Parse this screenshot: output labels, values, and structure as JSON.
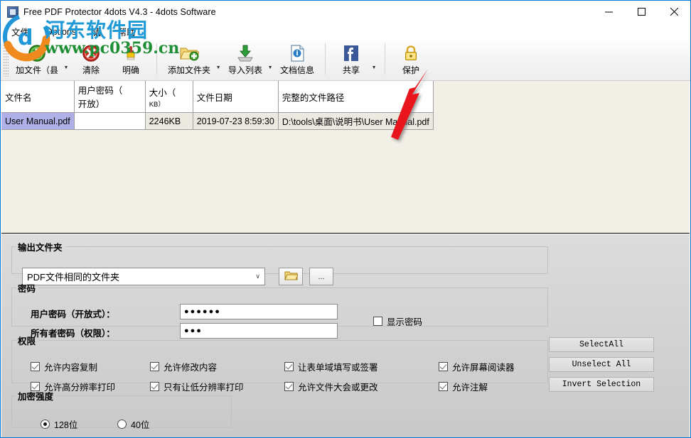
{
  "window": {
    "title": "Free PDF Protector 4dots V4.3 - 4dots Software",
    "icon": "app-icon",
    "minimize": "—",
    "maximize": "□",
    "close": "✕"
  },
  "menu": {
    "items": [
      {
        "label": "文件",
        "name": "menu-file"
      },
      {
        "label": "Options",
        "name": "menu-options"
      },
      {
        "label": "语",
        "name": "menu-language"
      },
      {
        "label": "帮助",
        "name": "menu-help"
      }
    ]
  },
  "toolbar": {
    "items": [
      {
        "label": "加文件（县",
        "icon": "add-file-icon",
        "dropdown": true
      },
      {
        "label": "清除",
        "icon": "remove-icon",
        "dropdown": false
      },
      {
        "label": "明确",
        "icon": "clear-brush-icon",
        "dropdown": false
      },
      {
        "label": "添加文件夹",
        "icon": "add-folder-icon",
        "dropdown": true
      },
      {
        "label": "导入列表",
        "icon": "import-list-icon",
        "dropdown": true
      },
      {
        "label": "文档信息",
        "icon": "document-info-icon",
        "dropdown": false
      },
      {
        "label": "共享",
        "icon": "facebook-share-icon",
        "dropdown": true
      },
      {
        "label": "保护",
        "icon": "lock-protect-icon",
        "dropdown": false
      }
    ],
    "dropdown_glyph": "▼"
  },
  "filelist": {
    "columns": [
      {
        "label": "文件名",
        "name": "column-filename"
      },
      {
        "label": "用户密码（",
        "label2": "开放）",
        "name": "column-userpassword"
      },
      {
        "label": "大小（",
        "label2": "KB）",
        "name": "column-size"
      },
      {
        "label": "文件日期",
        "name": "column-filedate"
      },
      {
        "label": "完整的文件路径",
        "name": "column-fullpath"
      }
    ],
    "rows": [
      {
        "filename": "User Manual.pdf",
        "userpassword": "",
        "size": "2246KB",
        "filedate": "2019-07-23 8:59:30",
        "fullpath": "D:\\tools\\桌面\\说明书\\User Manual.pdf",
        "selected": true
      }
    ]
  },
  "output_folder": {
    "legend": "输出文件夹",
    "combo_value": "PDF文件相同的文件夹",
    "combo_chevron": "∨",
    "browse_icon": "folder-icon",
    "dots_label": "..."
  },
  "password": {
    "legend": "密码",
    "user_label": "用户密码（开放式）：",
    "user_value": "●●●●●●",
    "owner_label": "所有者密码（权限）：",
    "owner_value": "●●●",
    "show_password_label": "显示密码",
    "show_password_checked": false
  },
  "permissions": {
    "legend": "权限",
    "items": [
      {
        "label": "允许内容复制",
        "checked": true,
        "name": "perm-allow-copy"
      },
      {
        "label": "允许修改内容",
        "checked": true,
        "name": "perm-allow-modify"
      },
      {
        "label": "让表单域填写或签署",
        "checked": true,
        "name": "perm-allow-formfill"
      },
      {
        "label": "允许屏幕阅读器",
        "checked": true,
        "name": "perm-allow-screenreader"
      },
      {
        "label": "允许高分辨率打印",
        "checked": true,
        "name": "perm-allow-highres-print"
      },
      {
        "label": "只有让低分辨率打印",
        "checked": true,
        "name": "perm-allow-lowres-print"
      },
      {
        "label": "允许文件大会或更改",
        "checked": true,
        "name": "perm-allow-assembly"
      },
      {
        "label": "允许注解",
        "checked": true,
        "name": "perm-allow-annotation"
      }
    ]
  },
  "selection_buttons": {
    "select_all": "SelectAll",
    "unselect_all": "Unselect All",
    "invert_selection": "Invert Selection"
  },
  "encryption": {
    "legend": "加密强度",
    "options": [
      {
        "label": "128位",
        "selected": true,
        "name": "radio-128bit"
      },
      {
        "label": "40位",
        "selected": false,
        "name": "radio-40bit"
      }
    ]
  },
  "watermark": {
    "text1": "河东软件园",
    "text2": "www.pc0359.cn"
  },
  "colors": {
    "accent": "#0078d7",
    "list_bg": "#f2efe6",
    "panel_bg": "#d0d0d0",
    "selection": "#b0b0e8",
    "arrow": "#e8191b"
  }
}
